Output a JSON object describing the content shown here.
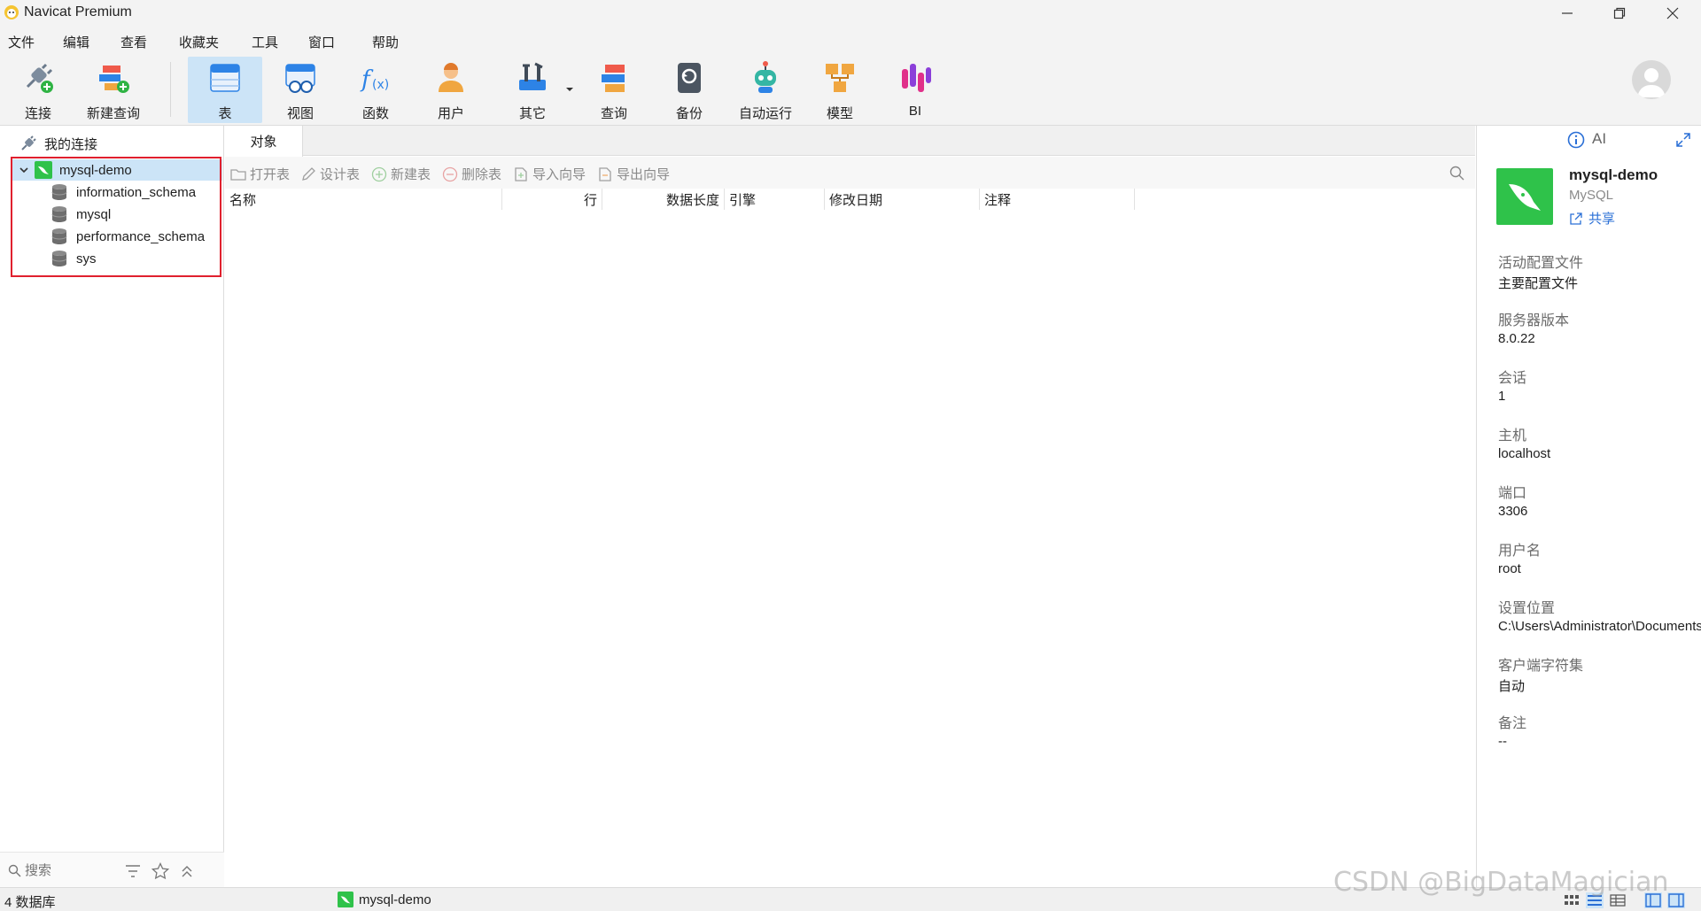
{
  "window": {
    "title": "Navicat Premium"
  },
  "menu": [
    "文件",
    "编辑",
    "查看",
    "收藏夹",
    "工具",
    "窗口",
    "帮助"
  ],
  "toolbar": {
    "connect": "连接",
    "new_query": "新建查询",
    "table": "表",
    "view": "视图",
    "function": "函数",
    "user": "用户",
    "other": "其它",
    "query": "查询",
    "backup": "备份",
    "automation": "自动运行",
    "model": "模型",
    "bi": "BI"
  },
  "navigator": {
    "root": "我的连接",
    "connection": "mysql-demo",
    "databases": [
      "information_schema",
      "mysql",
      "performance_schema",
      "sys"
    ],
    "search_placeholder": "搜索"
  },
  "center": {
    "tab": "对象",
    "actions": {
      "open": "打开表",
      "design": "设计表",
      "new": "新建表",
      "delete": "删除表",
      "import": "导入向导",
      "export": "导出向导"
    },
    "columns": [
      "名称",
      "行",
      "数据长度",
      "引擎",
      "修改日期",
      "注释"
    ]
  },
  "info_panel": {
    "ai_label": "AI",
    "name": "mysql-demo",
    "type": "MySQL",
    "share": "共享",
    "fields": [
      {
        "label": "活动配置文件",
        "value": "主要配置文件"
      },
      {
        "label": "服务器版本",
        "value": "8.0.22"
      },
      {
        "label": "会话",
        "value": "1"
      },
      {
        "label": "主机",
        "value": "localhost"
      },
      {
        "label": "端口",
        "value": "3306"
      },
      {
        "label": "用户名",
        "value": "root"
      },
      {
        "label": "设置位置",
        "value": "C:\\Users\\Administrator\\Documents"
      },
      {
        "label": "客户端字符集",
        "value": "自动"
      },
      {
        "label": "备注",
        "value": "--"
      }
    ]
  },
  "status": {
    "db_count": "4 数据库",
    "active_connection": "mysql-demo"
  },
  "watermark": "CSDN @BigDataMagician",
  "colors": {
    "mysql_green": "#2fc24a",
    "selection": "#cce4f7",
    "highlight_border": "#e0202e",
    "link_blue": "#2a6fd6"
  }
}
